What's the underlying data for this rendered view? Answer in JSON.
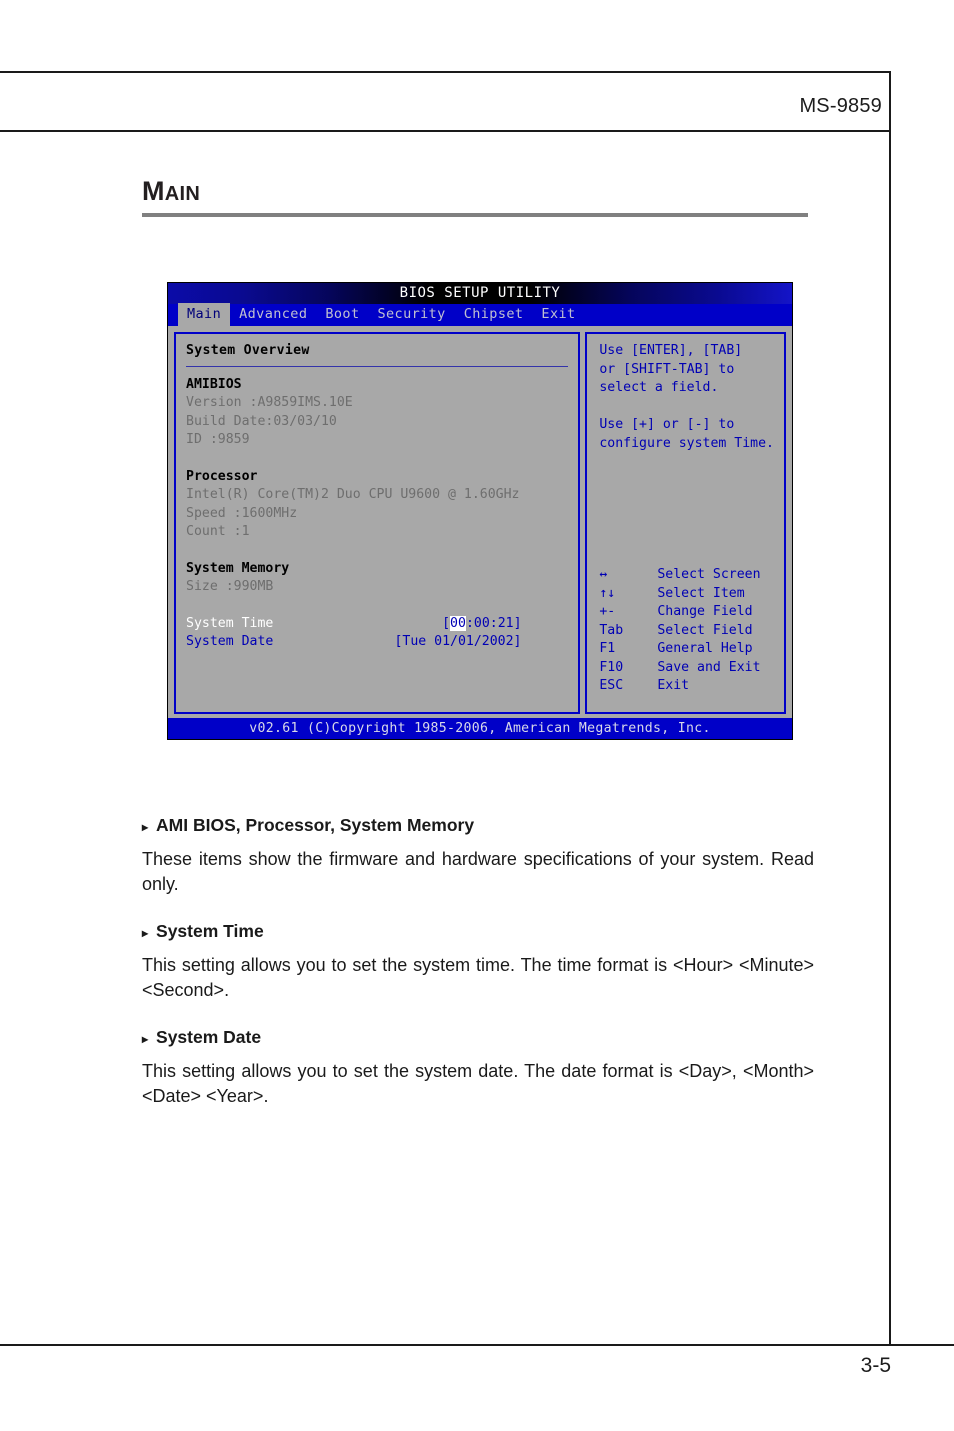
{
  "page": {
    "header_code": "MS-9859",
    "page_number": "3-5",
    "section_title_cap": "M",
    "section_title_rest": "AIN"
  },
  "bios": {
    "title": "BIOS SETUP UTILITY",
    "menu_tabs": [
      {
        "label": "Main",
        "active": true
      },
      {
        "label": "Advanced",
        "active": false
      },
      {
        "label": "Boot",
        "active": false
      },
      {
        "label": "Security",
        "active": false
      },
      {
        "label": "Chipset",
        "active": false
      },
      {
        "label": "Exit",
        "active": false
      }
    ],
    "left_panel": {
      "overview_title": "System Overview",
      "groups": [
        {
          "name": "AMIBIOS",
          "lines": [
            "Version   :A9859IMS.10E",
            "Build Date:03/03/10",
            "ID        :9859"
          ]
        },
        {
          "name": "Processor",
          "lines": [
            "Intel(R) Core(TM)2 Duo CPU    U9600  @ 1.60GHz",
            "Speed     :1600MHz",
            "Count     :1"
          ]
        },
        {
          "name": "System Memory",
          "lines": [
            "Size      :990MB"
          ]
        }
      ],
      "fields": [
        {
          "label": "System Time",
          "selected": true,
          "value_prefix": "[",
          "value_cursor": "00",
          "value_suffix": ":00:21]"
        },
        {
          "label": "System Date",
          "selected": false,
          "value_prefix": "",
          "value_cursor": "",
          "value_suffix": "[Tue 01/01/2002]"
        }
      ]
    },
    "right_panel": {
      "help_block_1": [
        "Use [ENTER], [TAB]",
        "or [SHIFT-TAB] to",
        "select a field."
      ],
      "help_block_2": [
        "Use [+] or [-] to",
        "configure system Time."
      ],
      "key_legend": [
        {
          "key": "↔",
          "action": "Select Screen"
        },
        {
          "key": "↑↓",
          "action": "Select Item"
        },
        {
          "key": "+-",
          "action": "Change Field"
        },
        {
          "key": "Tab",
          "action": "Select Field"
        },
        {
          "key": "F1",
          "action": "General Help"
        },
        {
          "key": "F10",
          "action": "Save and Exit"
        },
        {
          "key": "ESC",
          "action": "Exit"
        }
      ]
    },
    "footer": "v02.61 (C)Copyright 1985-2006, American Megatrends, Inc."
  },
  "copy": {
    "bullet": "▸",
    "items": [
      {
        "heading": "AMI BIOS, Processor, System Memory",
        "body": "These items show the firmware and hardware specifications of your system. Read only."
      },
      {
        "heading": "System Time",
        "body": "This setting allows you to set the system time. The time format is <Hour> <Minute> <Second>."
      },
      {
        "heading": "System Date",
        "body": "This setting allows you to set the system date. The date format is <Day>, <Month> <Date> <Year>."
      }
    ]
  },
  "colors": {
    "bios_blue": "#0000c8",
    "bios_gray": "#a8a8a8",
    "accent_rule": "#808080"
  }
}
